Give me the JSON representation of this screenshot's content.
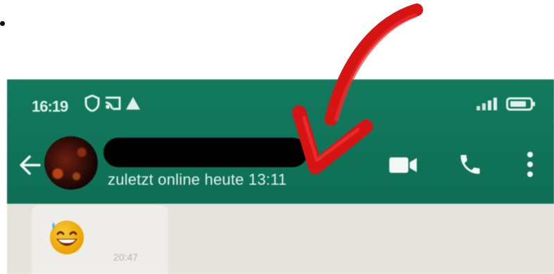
{
  "status_bar": {
    "time": "16:19",
    "left_icons": [
      "shield-icon",
      "cast-icon",
      "warning-icon"
    ],
    "right_icons": [
      "signal-icon",
      "battery-icon"
    ]
  },
  "chat_header": {
    "contact_name": "",
    "last_seen": "zuletzt online heute 13:11",
    "icons": [
      "back-arrow-icon",
      "video-call-icon",
      "phone-icon",
      "more-vert-icon"
    ]
  },
  "message": {
    "emoji": "grinning-sweat-emoji",
    "time": "20:47"
  },
  "colors": {
    "header": "#0f7a5c",
    "chat_background": "#e6e2dc",
    "bubble": "#efede9",
    "annotation_arrow": "#e21b1b"
  }
}
